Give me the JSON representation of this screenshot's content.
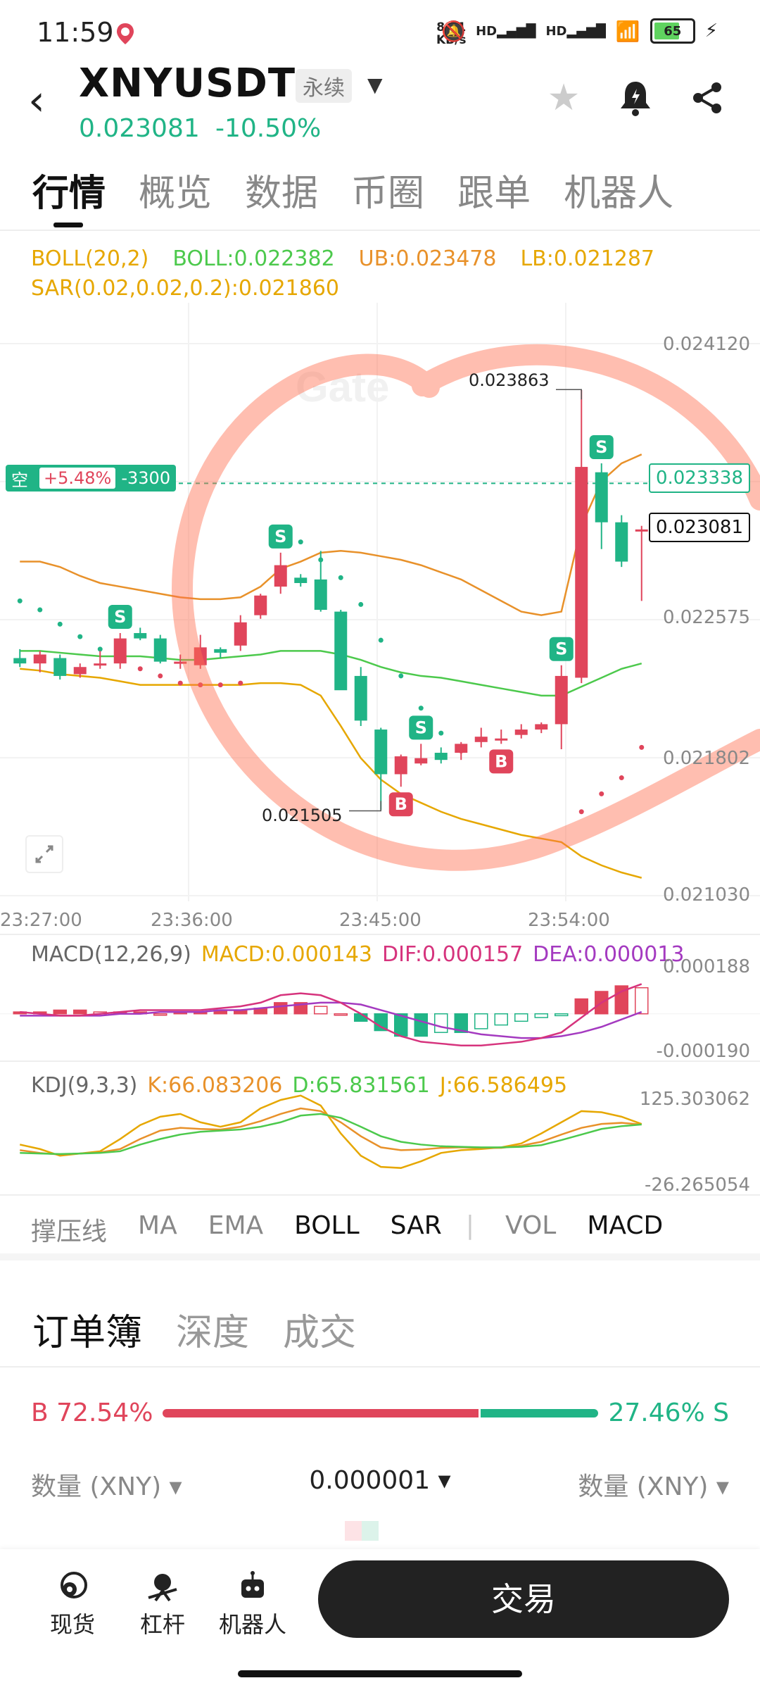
{
  "status": {
    "time": "11:59",
    "net_speed_value": "89.1",
    "net_speed_unit": "KB/s",
    "hd1": "HD",
    "hd2": "HD",
    "battery": "65"
  },
  "header": {
    "symbol": "XNYUSDT",
    "contract": "永续",
    "price": "0.023081",
    "change": "-10.50%"
  },
  "tabs": [
    "行情",
    "概览",
    "数据",
    "币圈",
    "跟单",
    "机器人"
  ],
  "indicators": {
    "boll_name": "BOLL(20,2)",
    "boll_mid": "BOLL:0.022382",
    "boll_ub": "UB:0.023478",
    "boll_lb": "LB:0.021287",
    "sar": "SAR(0.02,0.02,0.2):0.021860"
  },
  "y_axis": [
    "0.024120",
    "0.022575",
    "0.021802",
    "0.021030"
  ],
  "x_axis": [
    "23:27:00",
    "23:36:00",
    "23:45:00",
    "23:54:00"
  ],
  "position": {
    "side": "空",
    "pnl": "+5.48%",
    "qty": "-3300"
  },
  "price_tags": {
    "entry": "0.023338",
    "last": "0.023081"
  },
  "extremes": {
    "high": "0.023863",
    "low": "0.021505"
  },
  "macd": {
    "name": "MACD(12,26,9)",
    "macd": "MACD:0.000143",
    "dif": "DIF:0.000157",
    "dea": "DEA:0.000013",
    "max": "0.000188",
    "min": "-0.000190"
  },
  "kdj": {
    "name": "KDJ(9,3,3)",
    "k": "K:66.083206",
    "d": "D:65.831561",
    "j": "J:66.586495",
    "max": "125.303062",
    "min": "-26.265054"
  },
  "indicator_tabs": [
    "撑压线",
    "MA",
    "EMA",
    "BOLL",
    "SAR",
    "VOL",
    "MACD"
  ],
  "orderbook": {
    "tabs": [
      "订单簿",
      "深度",
      "成交"
    ],
    "buy_pct": "B 72.54%",
    "sell_pct": "27.46% S",
    "buy_ratio": 0.7254,
    "col_left": "数量 (XNY) ▾",
    "precision": "0.000001 ▾",
    "col_right": "数量 (XNY) ▾"
  },
  "bottom_nav": [
    "现货",
    "杠杆",
    "机器人"
  ],
  "trade_button": "交易",
  "colors": {
    "up": "#20b486",
    "down": "#e0455b",
    "boll_mid": "#4cc94c",
    "boll_band": "#e6a700"
  },
  "chart_data": {
    "type": "candlestick",
    "x_ticks": [
      "23:27:00",
      "23:36:00",
      "23:45:00",
      "23:54:00"
    ],
    "ylim": [
      0.02103,
      0.02412
    ],
    "annotations": {
      "high": 0.023863,
      "low": 0.021505
    },
    "candles": [
      {
        "o": 0.02236,
        "h": 0.02241,
        "l": 0.02231,
        "c": 0.02233
      },
      {
        "o": 0.02233,
        "h": 0.0224,
        "l": 0.02228,
        "c": 0.02238
      },
      {
        "o": 0.02236,
        "h": 0.02238,
        "l": 0.02224,
        "c": 0.02226
      },
      {
        "o": 0.02227,
        "h": 0.02233,
        "l": 0.02225,
        "c": 0.02231
      },
      {
        "o": 0.02232,
        "h": 0.0224,
        "l": 0.0223,
        "c": 0.02233
      },
      {
        "o": 0.02233,
        "h": 0.0225,
        "l": 0.0223,
        "c": 0.02247
      },
      {
        "o": 0.0225,
        "h": 0.02253,
        "l": 0.02246,
        "c": 0.02247
      },
      {
        "o": 0.02247,
        "h": 0.02249,
        "l": 0.02233,
        "c": 0.02234
      },
      {
        "o": 0.02234,
        "h": 0.02238,
        "l": 0.0223,
        "c": 0.02234
      },
      {
        "o": 0.02232,
        "h": 0.02249,
        "l": 0.0223,
        "c": 0.02242
      },
      {
        "o": 0.02241,
        "h": 0.02242,
        "l": 0.02236,
        "c": 0.02239
      },
      {
        "o": 0.02243,
        "h": 0.0226,
        "l": 0.0224,
        "c": 0.02256
      },
      {
        "o": 0.0226,
        "h": 0.02272,
        "l": 0.02258,
        "c": 0.02271
      },
      {
        "o": 0.02276,
        "h": 0.02295,
        "l": 0.02272,
        "c": 0.02288
      },
      {
        "o": 0.02281,
        "h": 0.02283,
        "l": 0.02276,
        "c": 0.02278
      },
      {
        "o": 0.0228,
        "h": 0.02296,
        "l": 0.02262,
        "c": 0.02263
      },
      {
        "o": 0.02262,
        "h": 0.02263,
        "l": 0.02219,
        "c": 0.02218
      },
      {
        "o": 0.02226,
        "h": 0.02231,
        "l": 0.02198,
        "c": 0.02201
      },
      {
        "o": 0.02196,
        "h": 0.02197,
        "l": 0.02151,
        "c": 0.02171
      },
      {
        "o": 0.02171,
        "h": 0.02182,
        "l": 0.02164,
        "c": 0.02181
      },
      {
        "o": 0.02177,
        "h": 0.02188,
        "l": 0.02176,
        "c": 0.0218
      },
      {
        "o": 0.02183,
        "h": 0.02186,
        "l": 0.02177,
        "c": 0.02179
      },
      {
        "o": 0.02183,
        "h": 0.02189,
        "l": 0.02179,
        "c": 0.02188
      },
      {
        "o": 0.02189,
        "h": 0.02197,
        "l": 0.02186,
        "c": 0.02192
      },
      {
        "o": 0.0219,
        "h": 0.02196,
        "l": 0.02188,
        "c": 0.02191
      },
      {
        "o": 0.02193,
        "h": 0.02199,
        "l": 0.02191,
        "c": 0.02196
      },
      {
        "o": 0.02196,
        "h": 0.022,
        "l": 0.02194,
        "c": 0.02199
      },
      {
        "o": 0.02199,
        "h": 0.02232,
        "l": 0.02185,
        "c": 0.02226
      },
      {
        "o": 0.02225,
        "h": 0.02386,
        "l": 0.02222,
        "c": 0.02343
      },
      {
        "o": 0.0234,
        "h": 0.02345,
        "l": 0.02297,
        "c": 0.02312
      },
      {
        "o": 0.02312,
        "h": 0.02316,
        "l": 0.02287,
        "c": 0.0229
      },
      {
        "o": 0.02307,
        "h": 0.0231,
        "l": 0.02268,
        "c": 0.02308
      }
    ],
    "signals": [
      {
        "i": 5,
        "t": "S",
        "pos": "above"
      },
      {
        "i": 13,
        "t": "S",
        "pos": "above"
      },
      {
        "i": 19,
        "t": "B",
        "pos": "below"
      },
      {
        "i": 20,
        "t": "S",
        "pos": "above"
      },
      {
        "i": 24,
        "t": "B",
        "pos": "below"
      },
      {
        "i": 27,
        "t": "S",
        "pos": "above"
      },
      {
        "i": 29,
        "t": "S",
        "pos": "above"
      }
    ],
    "boll_mid": [
      0.0224,
      0.0224,
      0.02239,
      0.02238,
      0.02237,
      0.02237,
      0.02237,
      0.02236,
      0.02235,
      0.02235,
      0.02236,
      0.02237,
      0.02238,
      0.0224,
      0.0224,
      0.0224,
      0.02238,
      0.02235,
      0.02231,
      0.02228,
      0.02226,
      0.02225,
      0.02223,
      0.02221,
      0.02219,
      0.02217,
      0.02215,
      0.02215,
      0.0222,
      0.02225,
      0.0223,
      0.02233
    ],
    "boll_ub": [
      0.0229,
      0.0229,
      0.02287,
      0.02282,
      0.02278,
      0.02276,
      0.02274,
      0.02272,
      0.0227,
      0.02269,
      0.02269,
      0.0227,
      0.02276,
      0.02286,
      0.0229,
      0.02295,
      0.02296,
      0.02295,
      0.02293,
      0.02291,
      0.02288,
      0.02284,
      0.0228,
      0.02274,
      0.02268,
      0.02262,
      0.0226,
      0.02262,
      0.0231,
      0.02335,
      0.02345,
      0.0235
    ],
    "boll_lb": [
      0.0223,
      0.02229,
      0.02227,
      0.02226,
      0.02225,
      0.02223,
      0.02221,
      0.02221,
      0.02221,
      0.02221,
      0.02221,
      0.02221,
      0.02222,
      0.02222,
      0.02221,
      0.02215,
      0.02198,
      0.0218,
      0.02168,
      0.0216,
      0.02155,
      0.0215,
      0.02146,
      0.02143,
      0.0214,
      0.02137,
      0.02135,
      0.02133,
      0.02125,
      0.0212,
      0.02116,
      0.02113
    ],
    "sar": [
      0.02268,
      0.02263,
      0.02255,
      0.02248,
      0.02241,
      0.02236,
      0.0223,
      0.02226,
      0.02222,
      0.02221,
      0.02221,
      0.02222,
      null,
      0.02286,
      0.02301,
      0.02291,
      0.02281,
      0.02266,
      0.02246,
      0.02226,
      0.02208,
      0.02194,
      0.02184,
      null,
      null,
      null,
      null,
      null,
      0.0215,
      0.0216,
      0.02169,
      0.02186
    ],
    "macd_hist": [
      1e-05,
      1e-05,
      2e-05,
      2e-05,
      1e-05,
      1e-05,
      1e-05,
      0.0,
      1e-05,
      1e-05,
      2e-05,
      2e-05,
      3e-05,
      6e-05,
      6e-05,
      4e-05,
      0.0,
      -4e-05,
      -9e-05,
      -0.00012,
      -0.00012,
      -0.0001,
      -0.0001,
      -8e-05,
      -6e-05,
      -4e-05,
      -2e-05,
      -1e-05,
      8e-05,
      0.00012,
      0.00015,
      0.00014
    ],
    "macd_dif": [
      1e-05,
      0.0,
      -1e-05,
      -1e-05,
      0.0,
      1e-05,
      2e-05,
      2e-05,
      2e-05,
      2e-05,
      3e-05,
      4e-05,
      6e-05,
      0.0001,
      0.00011,
      0.0001,
      6e-05,
      0.0,
      -7e-05,
      -0.00012,
      -0.00015,
      -0.00016,
      -0.00017,
      -0.00017,
      -0.00016,
      -0.00015,
      -0.00013,
      -0.0001,
      -2e-05,
      6e-05,
      0.00012,
      0.00016
    ],
    "macd_dea": [
      -1e-05,
      -1e-05,
      -1e-05,
      -1e-05,
      -1e-05,
      0.0,
      0.0,
      1e-05,
      1e-05,
      1e-05,
      2e-05,
      2e-05,
      3e-05,
      4e-05,
      5e-05,
      6e-05,
      6e-05,
      5e-05,
      2e-05,
      -1e-05,
      -4e-05,
      -7e-05,
      -9e-05,
      -0.00011,
      -0.00012,
      -0.00013,
      -0.00013,
      -0.00012,
      -0.0001,
      -7e-05,
      -3e-05,
      1e-05
    ],
    "kdj_k": [
      20,
      15,
      12,
      14,
      16,
      22,
      40,
      55,
      60,
      58,
      57,
      62,
      72,
      85,
      95,
      90,
      70,
      45,
      25,
      20,
      21,
      24,
      25,
      24,
      24,
      28,
      35,
      48,
      60,
      67,
      69,
      66
    ],
    "kdj_d": [
      15,
      14,
      13,
      14,
      15,
      18,
      30,
      40,
      48,
      53,
      55,
      57,
      62,
      70,
      82,
      85,
      78,
      62,
      45,
      35,
      30,
      27,
      26,
      25,
      25,
      26,
      29,
      38,
      48,
      58,
      63,
      66
    ],
    "kdj_j": [
      30,
      22,
      10,
      14,
      18,
      40,
      65,
      80,
      85,
      70,
      62,
      70,
      95,
      110,
      118,
      100,
      50,
      10,
      -10,
      -12,
      0,
      15,
      20,
      22,
      25,
      32,
      50,
      70,
      90,
      88,
      80,
      67
    ]
  }
}
